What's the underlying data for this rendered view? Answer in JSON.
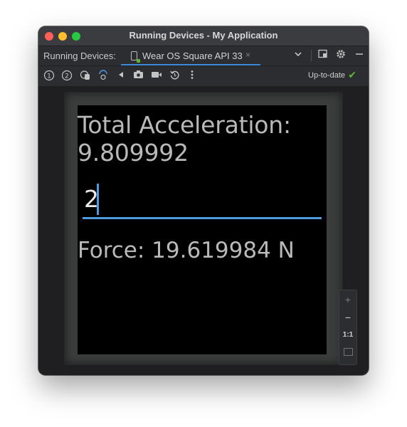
{
  "window": {
    "title": "Running Devices - My Application"
  },
  "tabbar": {
    "label": "Running Devices:",
    "device_tab": "Wear OS Square API 33",
    "close_glyph": "×",
    "right_icons": [
      "chevron-down-icon",
      "layout-icon",
      "gear-icon",
      "minimize-icon"
    ]
  },
  "toolbar": {
    "tools": [
      {
        "name": "button-1-icon",
        "glyph": "①"
      },
      {
        "name": "button-2-icon",
        "glyph": "②"
      },
      {
        "name": "palm-icon",
        "glyph": "✋"
      },
      {
        "name": "tilt-icon",
        "glyph": "↻"
      },
      {
        "name": "back-icon",
        "glyph": "◀"
      },
      {
        "name": "camera-icon",
        "glyph": "📷"
      },
      {
        "name": "record-icon",
        "glyph": "■"
      },
      {
        "name": "reset-icon",
        "glyph": "⟲"
      },
      {
        "name": "more-icon",
        "glyph": "⋮"
      }
    ],
    "status": "Up-to-date",
    "status_icon": "check-icon",
    "status_color": "#5fb832"
  },
  "watch": {
    "acceleration_line1": "Total Acceleration:",
    "acceleration_line2": "9.809992",
    "input_value": "2",
    "force": "Force: 19.619984 N",
    "accent_color": "#4d9be0"
  },
  "zoom": {
    "zoom_in": "+",
    "zoom_out": "−",
    "actual_size": "1:1",
    "fit_icon": "fit-screen-icon"
  }
}
